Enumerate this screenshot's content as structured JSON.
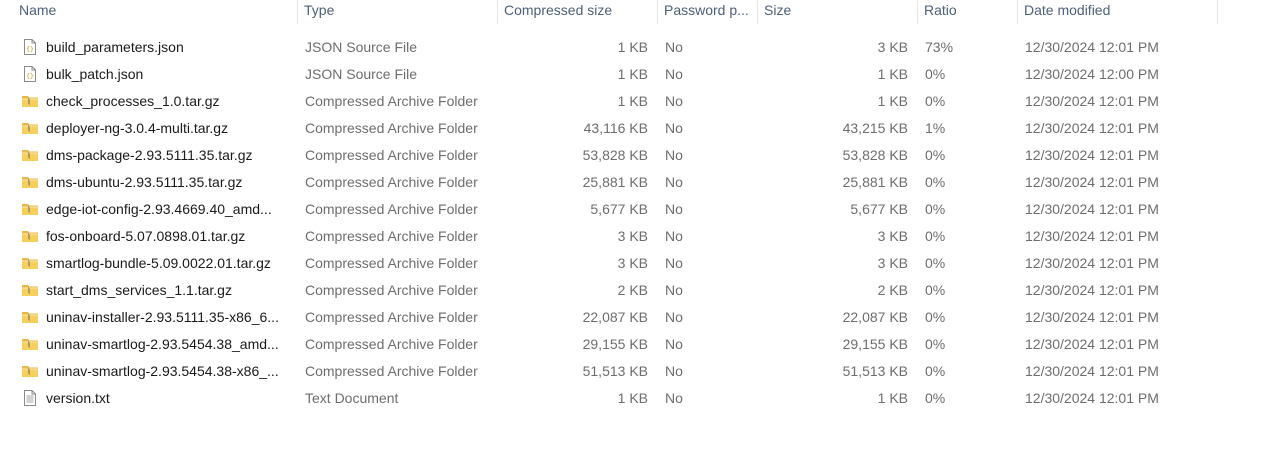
{
  "columns": {
    "name": "Name",
    "type": "Type",
    "compressed_size": "Compressed size",
    "password": "Password p...",
    "size": "Size",
    "ratio": "Ratio",
    "date_modified": "Date modified"
  },
  "files": [
    {
      "icon": "json-file-icon",
      "name": "build_parameters.json",
      "type": "JSON Source File",
      "compressed": "1 KB",
      "password": "No",
      "size": "3 KB",
      "ratio": "73%",
      "date": "12/30/2024 12:01 PM"
    },
    {
      "icon": "json-file-icon",
      "name": "bulk_patch.json",
      "type": "JSON Source File",
      "compressed": "1 KB",
      "password": "No",
      "size": "1 KB",
      "ratio": "0%",
      "date": "12/30/2024 12:00 PM"
    },
    {
      "icon": "zip-folder-icon",
      "name": "check_processes_1.0.tar.gz",
      "type": "Compressed Archive Folder",
      "compressed": "1 KB",
      "password": "No",
      "size": "1 KB",
      "ratio": "0%",
      "date": "12/30/2024 12:01 PM"
    },
    {
      "icon": "zip-folder-icon",
      "name": "deployer-ng-3.0.4-multi.tar.gz",
      "type": "Compressed Archive Folder",
      "compressed": "43,116 KB",
      "password": "No",
      "size": "43,215 KB",
      "ratio": "1%",
      "date": "12/30/2024 12:01 PM"
    },
    {
      "icon": "zip-folder-icon",
      "name": "dms-package-2.93.5111.35.tar.gz",
      "type": "Compressed Archive Folder",
      "compressed": "53,828 KB",
      "password": "No",
      "size": "53,828 KB",
      "ratio": "0%",
      "date": "12/30/2024 12:01 PM"
    },
    {
      "icon": "zip-folder-icon",
      "name": "dms-ubuntu-2.93.5111.35.tar.gz",
      "type": "Compressed Archive Folder",
      "compressed": "25,881 KB",
      "password": "No",
      "size": "25,881 KB",
      "ratio": "0%",
      "date": "12/30/2024 12:01 PM"
    },
    {
      "icon": "zip-folder-icon",
      "name": "edge-iot-config-2.93.4669.40_amd...",
      "type": "Compressed Archive Folder",
      "compressed": "5,677 KB",
      "password": "No",
      "size": "5,677 KB",
      "ratio": "0%",
      "date": "12/30/2024 12:01 PM"
    },
    {
      "icon": "zip-folder-icon",
      "name": "fos-onboard-5.07.0898.01.tar.gz",
      "type": "Compressed Archive Folder",
      "compressed": "3 KB",
      "password": "No",
      "size": "3 KB",
      "ratio": "0%",
      "date": "12/30/2024 12:01 PM"
    },
    {
      "icon": "zip-folder-icon",
      "name": "smartlog-bundle-5.09.0022.01.tar.gz",
      "type": "Compressed Archive Folder",
      "compressed": "3 KB",
      "password": "No",
      "size": "3 KB",
      "ratio": "0%",
      "date": "12/30/2024 12:01 PM"
    },
    {
      "icon": "zip-folder-icon",
      "name": "start_dms_services_1.1.tar.gz",
      "type": "Compressed Archive Folder",
      "compressed": "2 KB",
      "password": "No",
      "size": "2 KB",
      "ratio": "0%",
      "date": "12/30/2024 12:01 PM"
    },
    {
      "icon": "zip-folder-icon",
      "name": "uninav-installer-2.93.5111.35-x86_6...",
      "type": "Compressed Archive Folder",
      "compressed": "22,087 KB",
      "password": "No",
      "size": "22,087 KB",
      "ratio": "0%",
      "date": "12/30/2024 12:01 PM"
    },
    {
      "icon": "zip-folder-icon",
      "name": "uninav-smartlog-2.93.5454.38_amd...",
      "type": "Compressed Archive Folder",
      "compressed": "29,155 KB",
      "password": "No",
      "size": "29,155 KB",
      "ratio": "0%",
      "date": "12/30/2024 12:01 PM"
    },
    {
      "icon": "zip-folder-icon",
      "name": "uninav-smartlog-2.93.5454.38-x86_...",
      "type": "Compressed Archive Folder",
      "compressed": "51,513 KB",
      "password": "No",
      "size": "51,513 KB",
      "ratio": "0%",
      "date": "12/30/2024 12:01 PM"
    },
    {
      "icon": "text-file-icon",
      "name": "version.txt",
      "type": "Text Document",
      "compressed": "1 KB",
      "password": "No",
      "size": "1 KB",
      "ratio": "0%",
      "date": "12/30/2024 12:01 PM"
    }
  ]
}
